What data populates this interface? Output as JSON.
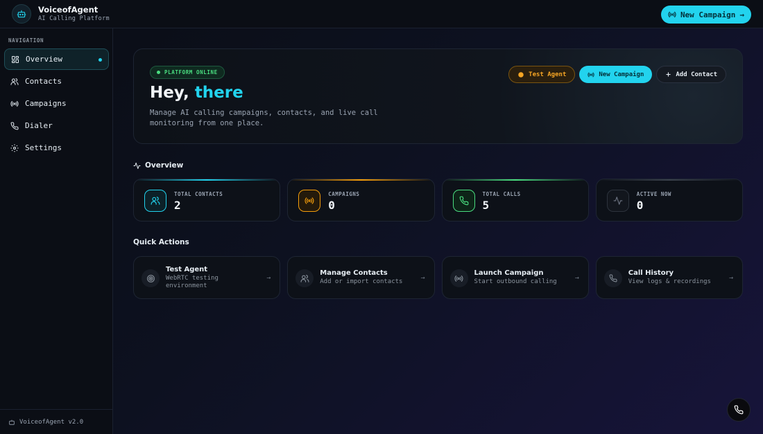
{
  "brand": {
    "name": "VoiceofAgent",
    "subtitle": "AI Calling Platform"
  },
  "topbar": {
    "cta_label": "New Campaign",
    "cta_arrow": "→"
  },
  "sidebar": {
    "heading": "NAVIGATION",
    "items": [
      {
        "label": "Overview",
        "icon": "grid-icon",
        "active": true
      },
      {
        "label": "Contacts",
        "icon": "users-icon"
      },
      {
        "label": "Campaigns",
        "icon": "broadcast-icon"
      },
      {
        "label": "Dialer",
        "icon": "phone-icon"
      },
      {
        "label": "Settings",
        "icon": "gear-icon"
      }
    ],
    "footer": "VoiceofAgent v2.0"
  },
  "hero": {
    "status": "PLATFORM ONLINE",
    "greeting": "Hey,",
    "name": "there",
    "description": "Manage AI calling campaigns, contacts, and live call monitoring from one place.",
    "buttons": {
      "test_agent": "Test Agent",
      "new_campaign": "New Campaign",
      "add_contact": "Add Contact"
    }
  },
  "overview": {
    "title": "Overview",
    "stats": [
      {
        "label": "TOTAL CONTACTS",
        "value": "2",
        "color": "#22d3ee"
      },
      {
        "label": "CAMPAIGNS",
        "value": "0",
        "color": "#f59e0b"
      },
      {
        "label": "TOTAL CALLS",
        "value": "5",
        "color": "#4ade80"
      },
      {
        "label": "ACTIVE NOW",
        "value": "0",
        "color": "#6b7280"
      }
    ]
  },
  "quick_actions": {
    "title": "Quick Actions",
    "items": [
      {
        "title": "Test Agent",
        "subtitle": "WebRTC testing environment",
        "arrow": "→"
      },
      {
        "title": "Manage Contacts",
        "subtitle": "Add or import contacts",
        "arrow": "→"
      },
      {
        "title": "Launch Campaign",
        "subtitle": "Start outbound calling",
        "arrow": "→"
      },
      {
        "title": "Call History",
        "subtitle": "View logs & recordings",
        "arrow": "→"
      }
    ]
  },
  "colors": {
    "accent": "#22d3ee",
    "success": "#4ade80",
    "warning": "#f59e0b"
  }
}
